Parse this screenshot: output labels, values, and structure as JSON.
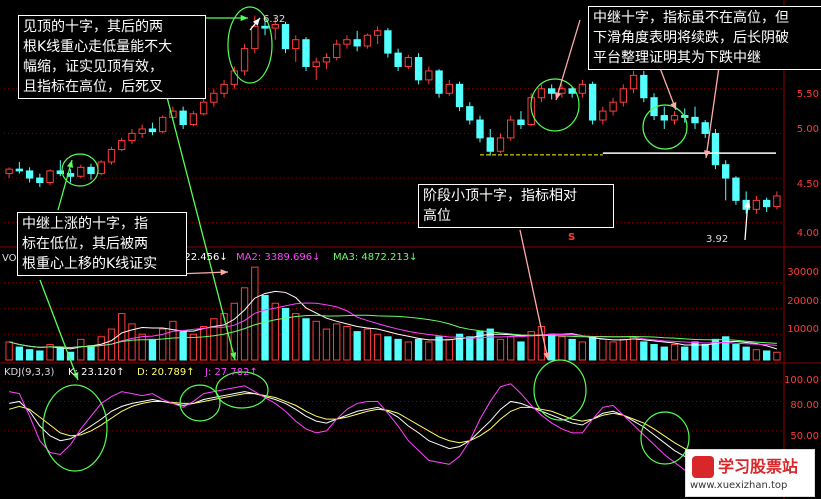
{
  "chart_data": {
    "type": "candlestick",
    "price_axis": {
      "ticks": [
        "5.50",
        "5.00",
        "4.50",
        "4.00"
      ],
      "ylim": [
        3.75,
        6.45
      ]
    },
    "annotations": {
      "high_label": "6.32",
      "low_label": "3.92",
      "marker": "S"
    },
    "candles": [
      [
        4.55,
        4.62,
        4.5,
        4.6
      ],
      [
        4.6,
        4.68,
        4.55,
        4.58
      ],
      [
        4.58,
        4.62,
        4.45,
        4.5
      ],
      [
        4.5,
        4.55,
        4.4,
        4.45
      ],
      [
        4.45,
        4.6,
        4.42,
        4.58
      ],
      [
        4.58,
        4.7,
        4.52,
        4.55
      ],
      [
        4.55,
        4.6,
        4.45,
        4.52
      ],
      [
        4.52,
        4.65,
        4.5,
        4.62
      ],
      [
        4.62,
        4.66,
        4.48,
        4.55
      ],
      [
        4.55,
        4.7,
        4.53,
        4.68
      ],
      [
        4.68,
        4.85,
        4.65,
        4.82
      ],
      [
        4.82,
        4.95,
        4.8,
        4.92
      ],
      [
        4.92,
        5.05,
        4.88,
        5.0
      ],
      [
        5.0,
        5.1,
        4.95,
        5.05
      ],
      [
        5.05,
        5.12,
        4.98,
        5.02
      ],
      [
        5.02,
        5.2,
        5.0,
        5.18
      ],
      [
        5.18,
        5.3,
        5.15,
        5.25
      ],
      [
        5.25,
        5.3,
        5.05,
        5.1
      ],
      [
        5.1,
        5.25,
        5.08,
        5.22
      ],
      [
        5.22,
        5.4,
        5.2,
        5.35
      ],
      [
        5.35,
        5.5,
        5.3,
        5.45
      ],
      [
        5.45,
        5.6,
        5.4,
        5.55
      ],
      [
        5.55,
        5.75,
        5.5,
        5.7
      ],
      [
        5.7,
        6.0,
        5.65,
        5.95
      ],
      [
        5.95,
        6.32,
        5.9,
        6.2
      ],
      [
        6.2,
        6.28,
        6.1,
        6.18
      ],
      [
        6.18,
        6.3,
        6.05,
        6.22
      ],
      [
        6.22,
        6.25,
        5.9,
        5.95
      ],
      [
        5.95,
        6.1,
        5.8,
        6.05
      ],
      [
        6.05,
        6.08,
        5.7,
        5.75
      ],
      [
        5.75,
        5.85,
        5.6,
        5.8
      ],
      [
        5.8,
        5.9,
        5.72,
        5.85
      ],
      [
        5.85,
        6.05,
        5.82,
        6.0
      ],
      [
        6.0,
        6.1,
        5.95,
        6.05
      ],
      [
        6.05,
        6.15,
        5.92,
        5.98
      ],
      [
        5.98,
        6.12,
        5.95,
        6.1
      ],
      [
        6.1,
        6.2,
        6.0,
        6.15
      ],
      [
        6.15,
        6.18,
        5.85,
        5.9
      ],
      [
        5.9,
        5.95,
        5.7,
        5.75
      ],
      [
        5.75,
        5.88,
        5.72,
        5.85
      ],
      [
        5.85,
        5.9,
        5.55,
        5.6
      ],
      [
        5.6,
        5.75,
        5.55,
        5.7
      ],
      [
        5.7,
        5.72,
        5.4,
        5.45
      ],
      [
        5.45,
        5.6,
        5.42,
        5.55
      ],
      [
        5.55,
        5.58,
        5.25,
        5.3
      ],
      [
        5.3,
        5.35,
        5.1,
        5.15
      ],
      [
        5.15,
        5.2,
        4.9,
        4.95
      ],
      [
        4.95,
        5.05,
        4.75,
        4.8
      ],
      [
        4.8,
        5.0,
        4.78,
        4.95
      ],
      [
        4.95,
        5.2,
        4.92,
        5.15
      ],
      [
        5.15,
        5.25,
        5.05,
        5.1
      ],
      [
        5.1,
        5.45,
        5.08,
        5.4
      ],
      [
        5.4,
        5.55,
        5.35,
        5.5
      ],
      [
        5.5,
        5.55,
        5.38,
        5.45
      ],
      [
        5.45,
        5.55,
        5.4,
        5.5
      ],
      [
        5.5,
        5.52,
        5.4,
        5.45
      ],
      [
        5.45,
        5.6,
        5.4,
        5.55
      ],
      [
        5.55,
        5.58,
        5.1,
        5.15
      ],
      [
        5.15,
        5.3,
        5.1,
        5.25
      ],
      [
        5.25,
        5.4,
        5.2,
        5.35
      ],
      [
        5.35,
        5.55,
        5.3,
        5.5
      ],
      [
        5.5,
        5.7,
        5.45,
        5.65
      ],
      [
        5.65,
        5.7,
        5.35,
        5.4
      ],
      [
        5.4,
        5.45,
        5.15,
        5.2
      ],
      [
        5.2,
        5.3,
        5.05,
        5.15
      ],
      [
        5.15,
        5.25,
        5.1,
        5.2
      ],
      [
        5.2,
        5.28,
        5.12,
        5.18
      ],
      [
        5.18,
        5.3,
        5.05,
        5.12
      ],
      [
        5.12,
        5.15,
        4.95,
        5.0
      ],
      [
        5.0,
        5.05,
        4.6,
        4.65
      ],
      [
        4.65,
        4.7,
        4.25,
        4.5
      ],
      [
        4.5,
        4.52,
        4.2,
        4.25
      ],
      [
        4.25,
        4.35,
        4.1,
        4.15
      ],
      [
        4.15,
        4.3,
        4.1,
        4.25
      ],
      [
        4.25,
        4.28,
        4.12,
        4.18
      ],
      [
        4.18,
        4.35,
        4.15,
        4.3
      ]
    ],
    "volume_axis": {
      "ticks": [
        "30000",
        "20000",
        "10000"
      ],
      "ylim": [
        0,
        38000
      ]
    },
    "volume_legend": {
      "ma1": "222.456↓",
      "ma2": "MA2: 3389.696↓",
      "ma3": "MA3: 4872.213↓"
    },
    "volume": [
      7000,
      5000,
      4000,
      3500,
      6000,
      5000,
      3000,
      8000,
      5500,
      9000,
      12000,
      18000,
      14000,
      10000,
      8000,
      12000,
      15000,
      11000,
      10000,
      13000,
      16000,
      18000,
      22000,
      28000,
      36000,
      25000,
      22000,
      20000,
      18000,
      16000,
      15000,
      12000,
      14000,
      13000,
      11000,
      12000,
      10000,
      9000,
      8000,
      7000,
      8000,
      7000,
      9000,
      8000,
      10000,
      9000,
      11000,
      12000,
      8000,
      9000,
      7000,
      11000,
      13000,
      10000,
      9000,
      8000,
      7000,
      9000,
      8000,
      7000,
      8000,
      9000,
      7000,
      6000,
      5000,
      6000,
      5000,
      7000,
      6000,
      8000,
      9000,
      6000,
      5000,
      4000,
      3500,
      3000
    ],
    "kdj_axis": {
      "ticks": [
        "100.00",
        "80.00",
        "50.00"
      ],
      "ylim": [
        0,
        110
      ]
    },
    "kdj_legend": {
      "title": "KDJ(9,3,3)",
      "k": "K: 23.120↑",
      "d": "D: 20.789↑",
      "j": "J: 27.782↑"
    },
    "kdj_k": [
      78,
      80,
      70,
      55,
      45,
      40,
      42,
      48,
      55,
      62,
      70,
      75,
      78,
      80,
      82,
      80,
      78,
      76,
      78,
      82,
      84,
      86,
      88,
      90,
      88,
      85,
      82,
      78,
      72,
      65,
      60,
      58,
      62,
      66,
      70,
      72,
      74,
      70,
      64,
      55,
      48,
      40,
      36,
      32,
      34,
      40,
      50,
      60,
      72,
      80,
      78,
      74,
      70,
      66,
      62,
      58,
      56,
      62,
      68,
      70,
      66,
      60,
      54,
      46,
      38,
      30,
      24,
      22,
      20,
      18,
      21,
      23
    ],
    "kdj_d": [
      72,
      75,
      72,
      64,
      56,
      48,
      45,
      46,
      50,
      56,
      63,
      70,
      75,
      78,
      80,
      80,
      79,
      78,
      78,
      80,
      82,
      84,
      86,
      88,
      88,
      86,
      84,
      80,
      76,
      70,
      65,
      62,
      62,
      64,
      67,
      70,
      72,
      71,
      68,
      62,
      56,
      50,
      44,
      40,
      38,
      40,
      45,
      52,
      62,
      70,
      74,
      74,
      72,
      70,
      66,
      62,
      60,
      62,
      66,
      68,
      66,
      62,
      58,
      52,
      45,
      38,
      32,
      28,
      24,
      21,
      21,
      21
    ],
    "kdj_j": [
      90,
      88,
      65,
      40,
      28,
      26,
      36,
      52,
      65,
      78,
      85,
      90,
      88,
      86,
      88,
      82,
      78,
      74,
      80,
      88,
      90,
      92,
      94,
      96,
      90,
      84,
      78,
      70,
      60,
      52,
      48,
      50,
      62,
      72,
      78,
      80,
      80,
      68,
      55,
      40,
      30,
      20,
      18,
      16,
      24,
      40,
      62,
      80,
      95,
      98,
      88,
      76,
      66,
      58,
      52,
      48,
      48,
      62,
      74,
      76,
      66,
      56,
      46,
      36,
      26,
      18,
      10,
      10,
      12,
      14,
      20,
      28
    ]
  },
  "notes": {
    "top_left": "见顶的十字，其后的两\n根K线重心走低量能不大\n幅缩，证实见顶有效，\n且指标在高位，后死叉",
    "mid_left": "中继上涨的十字，指\n标在低位，其后被两\n根重心上移的K线证实",
    "top_right": "中继十字，指标虽不在高位，但\n下滑角度表明将续跌，后长阴破\n平台整理证明其为下跌中继",
    "mid_center": "阶段小顶十字，指标相对\n高位"
  },
  "watermark": {
    "name": "学习股票站",
    "url": "www.xuexizhan.top"
  },
  "colors": {
    "up": "#ff3b3b",
    "down": "#54ffff",
    "grid": "#8b0000",
    "k": "#ffffff",
    "d": "#ffff66",
    "j": "#ff44ff"
  }
}
